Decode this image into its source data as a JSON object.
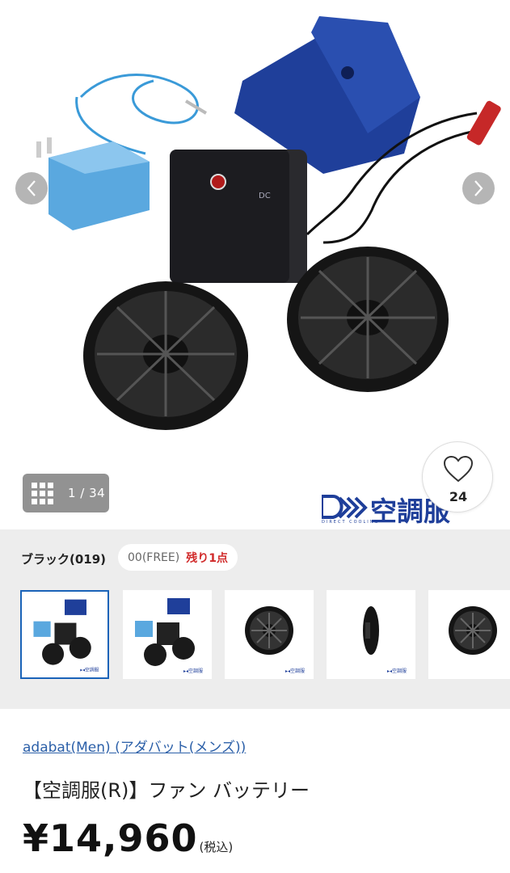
{
  "gallery": {
    "counter_text": "1 / 34",
    "favorite_count": "24",
    "brand_mark": "空調服",
    "brand_tagline": "DIRECT COOLING"
  },
  "variant": {
    "color_label": "ブラック(019)",
    "size_label": "00(FREE)",
    "stock_label": "残り1点",
    "thumbnails": [
      "thumb-1",
      "thumb-2",
      "thumb-3",
      "thumb-4",
      "thumb-5"
    ],
    "selected_index": 0
  },
  "product": {
    "brand_link": "adabat(Men) (アダバット(メンズ))",
    "title": "【空調服(R)】ファン バッテリー",
    "price": "¥14,960",
    "tax_label": "(税込)"
  },
  "colors": {
    "accent": "#1a63b8",
    "link": "#2b5fa8",
    "stock_red": "#d12b2b",
    "band_bg": "#ededed",
    "pouch_blue": "#1f3f9a",
    "charger_blue": "#5aa8df"
  }
}
